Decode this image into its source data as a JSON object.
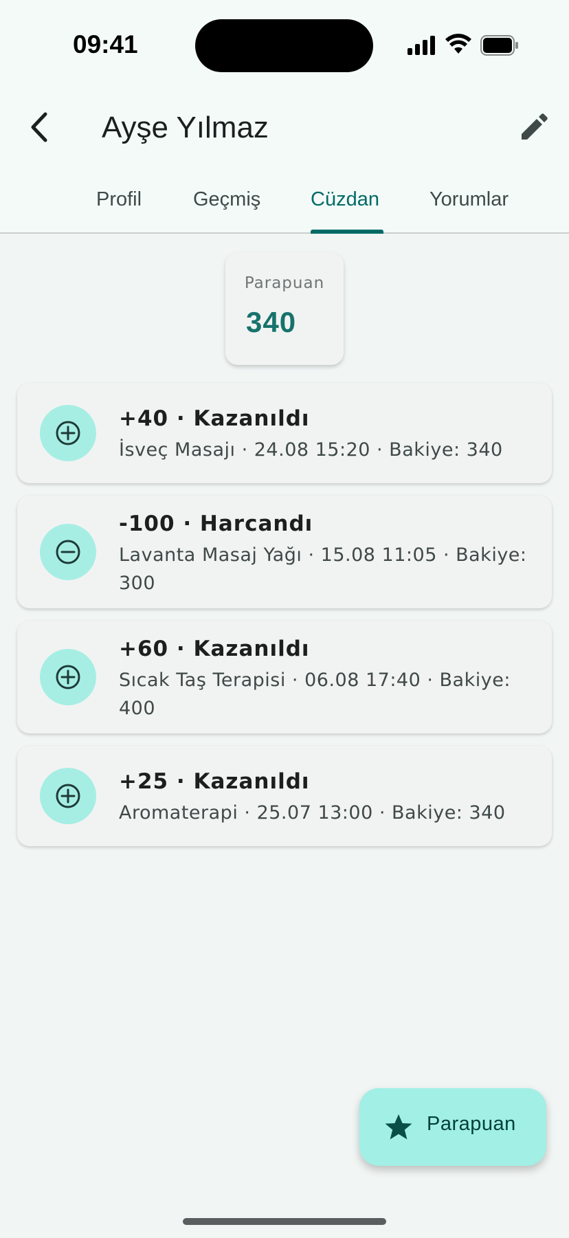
{
  "status_bar": {
    "time": "09:41"
  },
  "app_bar": {
    "title": "Ayşe Yılmaz"
  },
  "tabs": [
    {
      "label": "Profil",
      "active": false
    },
    {
      "label": "Geçmiş",
      "active": false
    },
    {
      "label": "Cüzdan",
      "active": true
    },
    {
      "label": "Yorumlar",
      "active": false
    }
  ],
  "balance": {
    "label": "Parapuan",
    "value": "340"
  },
  "transactions": [
    {
      "type": "earned",
      "icon": "plus-circle-icon",
      "title": "+40 · Kazanıldı",
      "subtitle": "İsveç Masajı · 24.08 15:20 · Bakiye: 340"
    },
    {
      "type": "spent",
      "icon": "minus-circle-icon",
      "title": "-100 · Harcandı",
      "subtitle": "Lavanta Masaj Yağı · 15.08 11:05 · Bakiye: 300"
    },
    {
      "type": "earned",
      "icon": "plus-circle-icon",
      "title": "+60 · Kazanıldı",
      "subtitle": "Sıcak Taş Terapisi · 06.08 17:40 · Bakiye: 400"
    },
    {
      "type": "earned",
      "icon": "plus-circle-icon",
      "title": "+25 · Kazanıldı",
      "subtitle": "Aromaterapi · 25.07 13:00 · Bakiye: 340"
    }
  ],
  "fab": {
    "label": "Parapuan",
    "icon": "star-icon"
  },
  "colors": {
    "accent": "#006b66",
    "icon_bg": "#a6eee4",
    "fab_bg": "#a1efe5",
    "background": "#f1f5f4"
  }
}
